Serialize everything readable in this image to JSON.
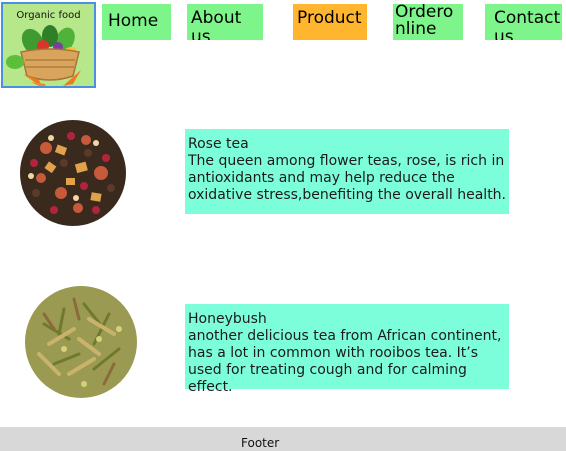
{
  "logo": {
    "text": "Organic food",
    "icon": "vegetable-basket-icon"
  },
  "nav": {
    "home": "Home",
    "about": "About us",
    "product": "Product",
    "order": "Orderonline",
    "contact": "Contact us",
    "active": "Product"
  },
  "products": [
    {
      "name": "Rose tea",
      "description": "The queen among flower teas, rose, is rich in antioxidants and may help reduce the oxidative stress,benefiting the overall health.",
      "image": "rose-tea-image"
    },
    {
      "name": "Honeybush",
      "description": "another delicious tea from African continent, has a lot in common with rooibos tea. It’s used for treating cough and for calming effect.",
      "image": "honeybush-tea-image"
    }
  ],
  "footer": {
    "text": "Footer"
  },
  "colors": {
    "nav_bg": "#7df58a",
    "nav_active_bg": "#ffb52e",
    "desc_bg": "#7dfedb",
    "footer_bg": "#d8d8d8",
    "logo_border": "#4a90e2"
  }
}
